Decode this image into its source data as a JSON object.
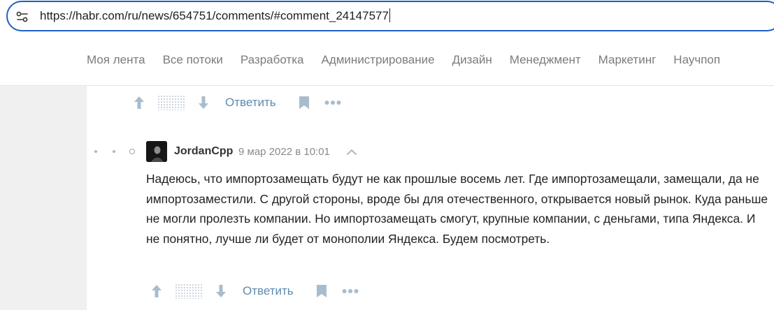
{
  "browser": {
    "url": "https://habr.com/ru/news/654751/comments/#comment_24147577"
  },
  "nav": {
    "items": [
      {
        "label": "Моя лента"
      },
      {
        "label": "Все потоки"
      },
      {
        "label": "Разработка"
      },
      {
        "label": "Администрирование"
      },
      {
        "label": "Дизайн"
      },
      {
        "label": "Менеджмент"
      },
      {
        "label": "Маркетинг"
      },
      {
        "label": "Научпоп"
      }
    ]
  },
  "previous_comment": {
    "reply_label": "Ответить"
  },
  "comment": {
    "author": "JordanCpp",
    "date": "9 мар 2022 в 10:01",
    "text": "Надеюсь, что импортозамещать будут не как прошлые восемь лет. Где импортозамещали, замещали, да не импортозаместили. С другой стороны, вроде бы для отечественного, открывается новый рынок. Куда раньше не могли пролезть компании. Но импортозамещать смогут, крупные компании, с деньгами, типа Яндекса. И не понятно, лучше ли будет от монополии Яндекса. Будем посмотреть.",
    "reply_label": "Ответить"
  },
  "icons": {
    "site_info": "tune-icon",
    "vote_up": "arrow-up-icon",
    "vote_down": "arrow-down-icon",
    "bookmark": "bookmark-icon",
    "more": "more-dots-icon",
    "collapse": "chevron-up-icon"
  },
  "colors": {
    "accent_border": "#1f5fc2",
    "link": "#5e8bad",
    "icon": "#a9bccb",
    "nav_text": "#7b7b7b",
    "page_bg": "#f0f0f0"
  }
}
